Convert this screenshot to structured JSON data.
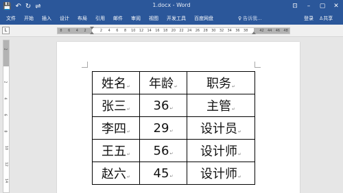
{
  "titlebar": {
    "qat": {
      "save": "💾",
      "undo": "↶",
      "redo": "↻",
      "customize": "⇌"
    },
    "title": "1.docx - Word",
    "controls": {
      "ribbon_options": "⊡",
      "minimize": "–",
      "maximize": "▢",
      "close": "✕"
    }
  },
  "ribbon": {
    "tabs": [
      "文件",
      "开始",
      "插入",
      "设计",
      "布局",
      "引用",
      "邮件",
      "审阅",
      "视图",
      "开发工具",
      "百度网盘"
    ],
    "tell_me": "告诉我...",
    "login": "登录",
    "share": "共享"
  },
  "ruler": {
    "corner": "L",
    "horizontal_numbers": [
      "8",
      "6",
      "4",
      "2",
      "",
      "2",
      "4",
      "6",
      "8",
      "10",
      "12",
      "14",
      "16",
      "18",
      "20",
      "22",
      "24",
      "26",
      "28",
      "30",
      "32",
      "34",
      "36",
      "38",
      "",
      "42",
      "44",
      "46",
      "48"
    ],
    "vertical_numbers": [
      "2",
      "",
      "2",
      "4",
      "6",
      "8",
      "10",
      "12",
      "14",
      "16"
    ]
  },
  "table": {
    "paragraph_mark": "↵",
    "rows": [
      [
        "姓名",
        "年龄",
        "职务"
      ],
      [
        "张三",
        "36",
        "主管"
      ],
      [
        "李四",
        "29",
        "设计员"
      ],
      [
        "王五",
        "56",
        "设计师"
      ],
      [
        "赵六",
        "45",
        "设计师"
      ]
    ]
  }
}
